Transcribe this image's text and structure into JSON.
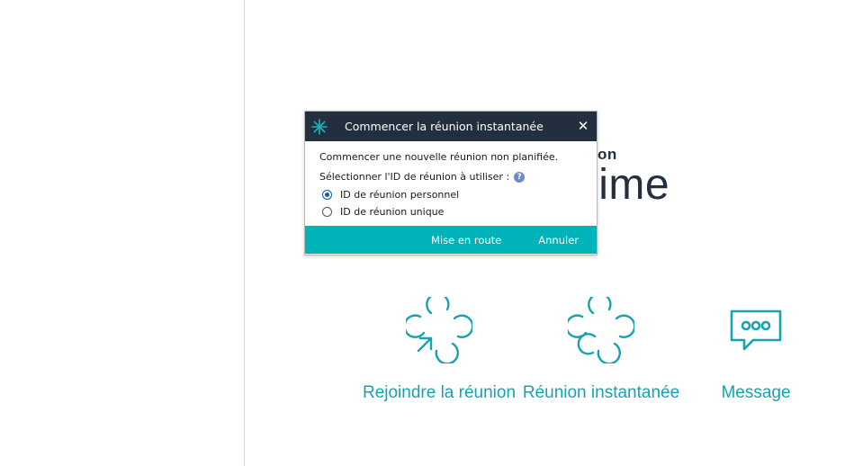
{
  "brand": {
    "small": "zon",
    "large": "nime"
  },
  "actions": [
    {
      "label": "Rejoindre la réunion",
      "icon": "join-meeting-icon"
    },
    {
      "label": "Réunion instantanée",
      "icon": "instant-meeting-icon"
    },
    {
      "label": "Message",
      "icon": "chat-bubble-icon"
    }
  ],
  "dialog": {
    "title": "Commencer la réunion instantanée",
    "close_glyph": "✕",
    "intro": "Commencer une nouvelle réunion non planifiée.",
    "select_label": "Sélectionner l'ID de réunion à utiliser :",
    "help_glyph": "?",
    "options": [
      {
        "label": "ID de réunion personnel",
        "selected": true
      },
      {
        "label": "ID de réunion unique",
        "selected": false
      }
    ],
    "start_label": "Mise en route",
    "cancel_label": "Annuler"
  },
  "colors": {
    "accent": "#16a3b0",
    "header": "#232f3e",
    "footer": "#00b3b9",
    "radio": "#0f5fa8"
  }
}
